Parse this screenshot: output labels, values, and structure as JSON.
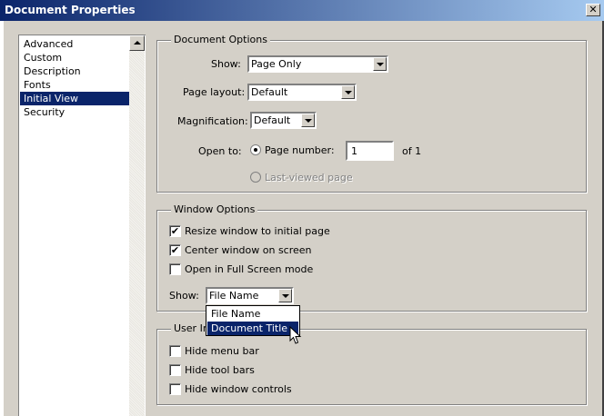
{
  "window": {
    "title": "Document Properties",
    "close_glyph": "✕"
  },
  "sidebar": {
    "items": [
      {
        "label": "Advanced"
      },
      {
        "label": "Custom"
      },
      {
        "label": "Description"
      },
      {
        "label": "Fonts"
      },
      {
        "label": "Initial View"
      },
      {
        "label": "Security"
      }
    ],
    "selected": "Initial View"
  },
  "document_options": {
    "legend": "Document Options",
    "show_label": "Show:",
    "show_value": "Page Only",
    "page_layout_label": "Page layout:",
    "page_layout_value": "Default",
    "magnification_label": "Magnification:",
    "magnification_value": "Default",
    "open_to_label": "Open to:",
    "page_number_label": "Page number:",
    "page_number_value": "1",
    "of_total": "of 1",
    "last_viewed_label": "Last-viewed page"
  },
  "window_options": {
    "legend": "Window Options",
    "resize_label": "Resize window to initial page",
    "resize_checked": true,
    "center_label": "Center window on screen",
    "center_checked": true,
    "fullscreen_label": "Open in Full Screen mode",
    "fullscreen_checked": false,
    "show_label": "Show:",
    "show_value": "File Name",
    "dropdown_options": [
      "File Name",
      "Document Title"
    ],
    "highlighted_option": "Document Title"
  },
  "user_interface_options": {
    "legend_visible": "User In",
    "hide_menu_bar_label": "Hide menu bar",
    "hide_tool_bars_label": "Hide tool bars",
    "hide_window_controls_label": "Hide window controls"
  },
  "colors": {
    "dialog_bg": "#d4d0c8",
    "selection": "#0a246a",
    "titlebar_start": "#0a246a",
    "titlebar_end": "#a6caf0"
  },
  "checkmark_glyph": "✔"
}
